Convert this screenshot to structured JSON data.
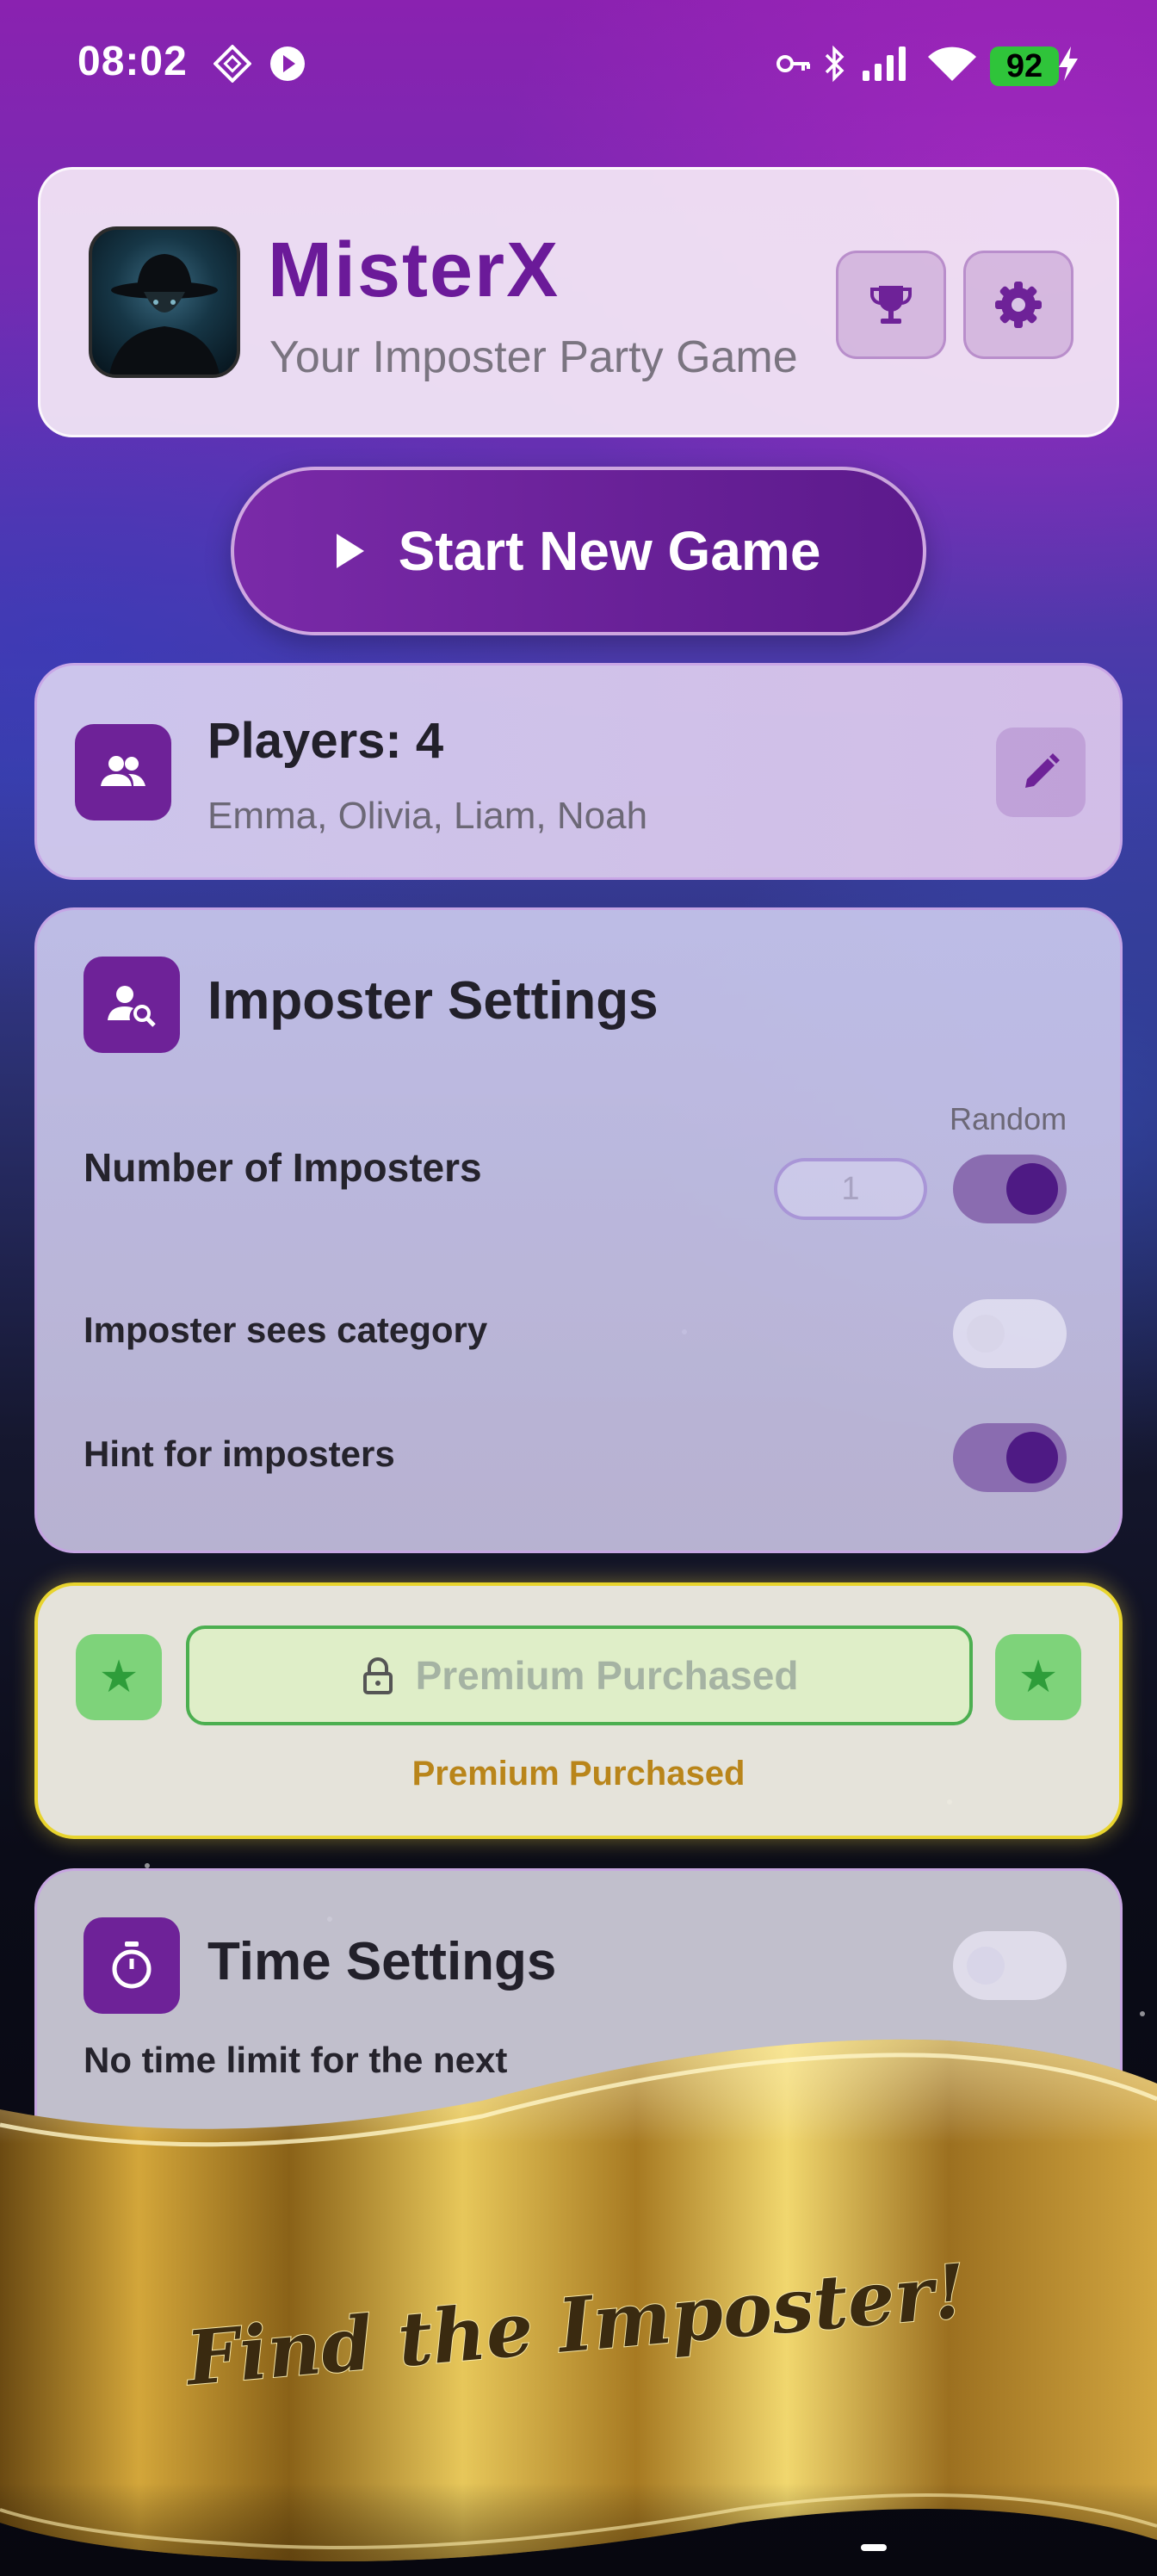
{
  "status_bar": {
    "time": "08:02",
    "battery": "92",
    "icons": [
      "nfc-icon",
      "play-badge-icon",
      "key-icon",
      "bluetooth-icon",
      "signal-icon",
      "wifi-icon",
      "battery-icon",
      "charging-icon"
    ]
  },
  "header": {
    "title": "MisterX",
    "subtitle": "Your Imposter Party Game",
    "buttons": [
      "trophy-icon",
      "gear-icon"
    ]
  },
  "start_button": {
    "label": "Start New Game"
  },
  "players": {
    "title": "Players: 4",
    "names": "Emma, Olivia, Liam, Noah"
  },
  "imposter_settings": {
    "title": "Imposter Settings",
    "random_label": "Random",
    "number_label": "Number of Imposters",
    "number_value": "1",
    "random_enabled": true,
    "sees_category_label": "Imposter sees category",
    "sees_category_enabled": false,
    "hint_label": "Hint for imposters",
    "hint_enabled": true
  },
  "premium": {
    "button_label": "Premium Purchased",
    "note": "Premium Purchased"
  },
  "time_settings": {
    "title": "Time Settings",
    "enabled": false,
    "description": "No time limit for the next"
  },
  "banner": {
    "text": "Find the Imposter!"
  },
  "colors": {
    "accent": "#6e2298",
    "title": "#6b1a99",
    "premium_border": "#e8d42e",
    "premium_green": "#4caf50",
    "premium_note": "#b9851a"
  }
}
